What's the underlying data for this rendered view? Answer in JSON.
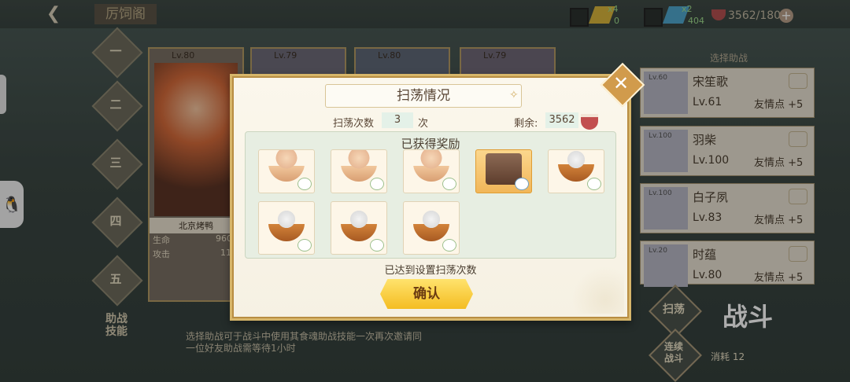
{
  "header": {
    "title": "厉饲阁",
    "back_label": "❮",
    "resources": [
      {
        "name": "ticket-yellow",
        "count": "x4"
      },
      {
        "name": "ticket-blue",
        "count": "x2"
      }
    ],
    "res_sub_1": "0",
    "res_sub_2": "404",
    "stamina": "3562/180",
    "plus": "+"
  },
  "stages": [
    "一",
    "二",
    "三",
    "四",
    "五"
  ],
  "heroes": [
    {
      "level": "Lv.80",
      "name": "北京烤鸭",
      "hp_label": "生命",
      "hp": "960",
      "atk_label": "攻击",
      "atk": "11"
    },
    {
      "level": "Lv.79"
    },
    {
      "level": "Lv.80"
    },
    {
      "level": "Lv.79"
    }
  ],
  "friends": {
    "header": "选择助战",
    "list": [
      {
        "avatar_level": "Lv.60",
        "name": "宋笙歌",
        "level": "Lv.61",
        "points": "友情点  +5"
      },
      {
        "avatar_level": "Lv.100",
        "name": "羽柴",
        "level": "Lv.100",
        "points": "友情点  +5"
      },
      {
        "avatar_level": "Lv.100",
        "name": "白子夙",
        "level": "Lv.83",
        "points": "友情点  +5"
      },
      {
        "avatar_level": "Lv.20",
        "name": "时蕴",
        "level": "Lv.80",
        "points": "友情点  +5"
      }
    ]
  },
  "side_buttons": {
    "sweep": "扫荡",
    "continuous": "连续\n战斗"
  },
  "help": {
    "label": "助战技能",
    "desc": "选择助战可于战斗中使用其食魂助战技能一次再次邀请同一位好友助战需等待1小时"
  },
  "fight": {
    "label": "战斗",
    "cost": "消耗  12"
  },
  "modal": {
    "title": "扫荡情况",
    "sweep_count_label": "扫荡次数",
    "sweep_count": "3",
    "sweep_unit": "次",
    "remaining_label": "剩余:",
    "remaining": "3562",
    "rewards_title": "已获得奖励",
    "rewards": [
      {
        "type": "bowl"
      },
      {
        "type": "bowl"
      },
      {
        "type": "bowl"
      },
      {
        "type": "mug",
        "rarity": "gold"
      },
      {
        "type": "pot"
      },
      {
        "type": "pot"
      },
      {
        "type": "pot"
      },
      {
        "type": "pot"
      }
    ],
    "done_text": "已达到设置扫荡次数",
    "confirm": "确认",
    "close": "✕"
  },
  "icons": {
    "title_deco": "✧"
  },
  "colors": {
    "accent_gold": "#d7b66a",
    "confirm_yellow": "#f4bd22",
    "panel_green": "#e7eee2"
  }
}
